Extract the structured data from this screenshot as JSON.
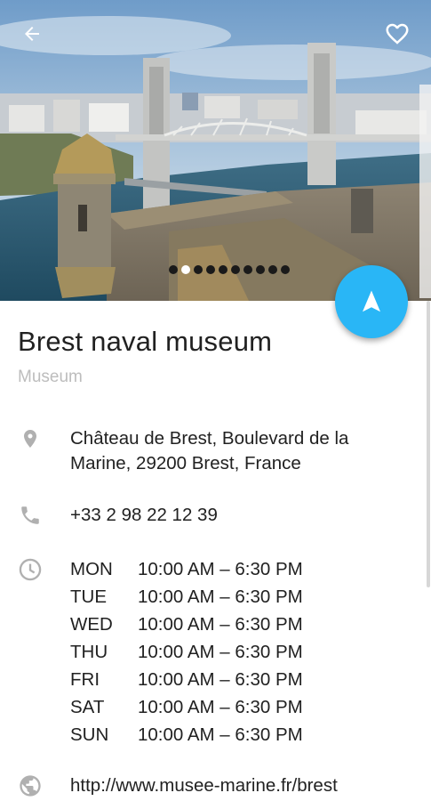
{
  "header": {
    "back_icon": "arrow-back-icon",
    "favorite_icon": "heart-outline-icon"
  },
  "gallery": {
    "image_count": 10,
    "active_index": 1
  },
  "fab": {
    "icon": "navigation-arrow-icon",
    "color": "#29b6f6"
  },
  "place": {
    "name": "Brest naval museum",
    "category": "Museum",
    "address_line1": "Château de Brest, Boulevard de la",
    "address_line2": "Marine, 29200 Brest, France",
    "phone": "+33 2 98 22 12 39",
    "hours": [
      {
        "day": "MON",
        "time": "10:00 AM – 6:30 PM"
      },
      {
        "day": "TUE",
        "time": "10:00 AM – 6:30 PM"
      },
      {
        "day": "WED",
        "time": "10:00 AM – 6:30 PM"
      },
      {
        "day": "THU",
        "time": "10:00 AM – 6:30 PM"
      },
      {
        "day": "FRI",
        "time": "10:00 AM – 6:30 PM"
      },
      {
        "day": "SAT",
        "time": "10:00 AM – 6:30 PM"
      },
      {
        "day": "SUN",
        "time": "10:00 AM – 6:30 PM"
      }
    ],
    "website": "http://www.musee-marine.fr/brest"
  },
  "icons": {
    "address": "location-pin-icon",
    "phone": "phone-icon",
    "hours": "clock-icon",
    "website": "globe-icon"
  }
}
